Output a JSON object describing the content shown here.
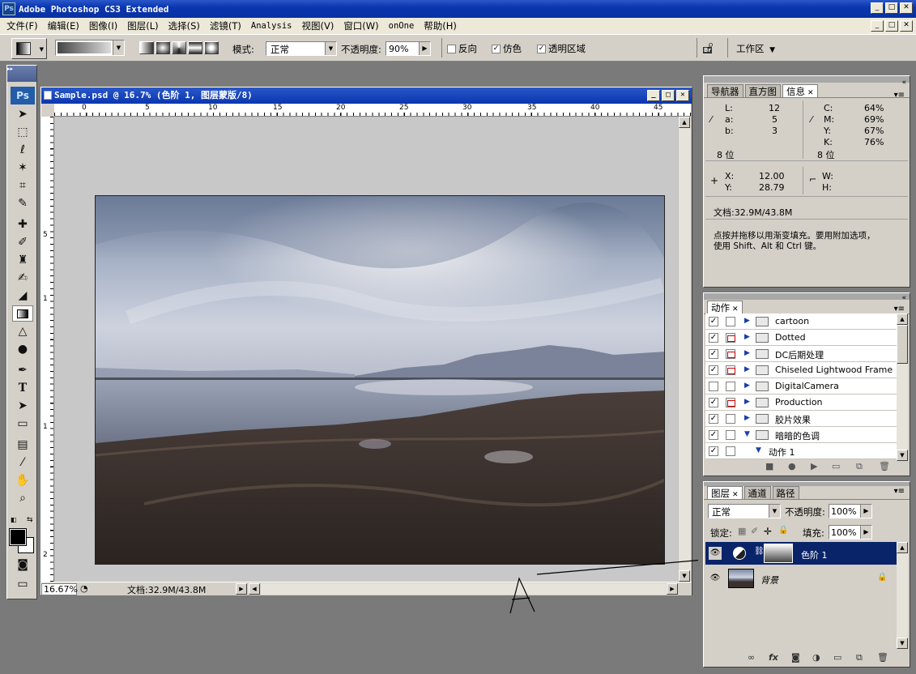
{
  "window": {
    "title": "Adobe Photoshop CS3 Extended",
    "app_icon": "Ps"
  },
  "menu": [
    "文件(F)",
    "编辑(E)",
    "图像(I)",
    "图层(L)",
    "选择(S)",
    "滤镜(T)",
    "Analysis",
    "视图(V)",
    "窗口(W)",
    "onOne",
    "帮助(H)"
  ],
  "options": {
    "mode_label": "模式:",
    "mode_value": "正常",
    "opacity_label": "不透明度:",
    "opacity_value": "90%",
    "reverse_label": "反向",
    "dither_label": "仿色",
    "transparency_label": "透明区域",
    "workspace_label": "工作区",
    "bridge_label": "Br"
  },
  "tools": {
    "logo": "Ps"
  },
  "document": {
    "title": "Sample.psd @ 16.7% (色阶 1, 图层蒙版/8)",
    "ruler_h": [
      "0",
      "5",
      "10",
      "15",
      "20",
      "25",
      "30",
      "35",
      "40",
      "45"
    ],
    "ruler_v": [
      "5",
      "1",
      "1",
      "2"
    ],
    "zoom": "16.67%",
    "doc_size": "文档:32.9M/43.8M"
  },
  "info_panel": {
    "tabs": [
      "导航器",
      "直方图",
      "信息"
    ],
    "L": "12",
    "a": "5",
    "b": "3",
    "C": "64%",
    "M": "69%",
    "Y": "67%",
    "K": "76%",
    "bit_left": "8 位",
    "bit_right": "8 位",
    "X": "12.00",
    "Yc": "28.79",
    "W": "",
    "H": "",
    "doc_size": "文档:32.9M/43.8M",
    "hint_line1": "点按并拖移以用渐变填充。要用附加选项，",
    "hint_line2": "使用 Shift、Alt 和 Ctrl 键。"
  },
  "actions_panel": {
    "tab": "动作",
    "rows": [
      {
        "label": "cartoon",
        "checked": true,
        "dialog": false,
        "open": false
      },
      {
        "label": "Dotted",
        "checked": true,
        "dialog": true,
        "open": false
      },
      {
        "label": "DC后期处理",
        "checked": true,
        "dialog": true,
        "open": false
      },
      {
        "label": "Chiseled Lightwood Frame",
        "checked": true,
        "dialog": true,
        "open": false
      },
      {
        "label": "DigitalCamera",
        "checked": false,
        "dialog": false,
        "open": false
      },
      {
        "label": "Production",
        "checked": true,
        "dialog": true,
        "open": false
      },
      {
        "label": "胶片效果",
        "checked": true,
        "dialog": false,
        "open": false
      },
      {
        "label": "暗暗的色调",
        "checked": true,
        "dialog": false,
        "open": true
      },
      {
        "label": "动作 1",
        "checked": true,
        "dialog": false,
        "open": true
      }
    ]
  },
  "layers_panel": {
    "tabs": [
      "图层",
      "通道",
      "路径"
    ],
    "blend_mode": "正常",
    "opacity_label": "不透明度:",
    "opacity_value": "100%",
    "lock_label": "锁定:",
    "fill_label": "填充:",
    "fill_value": "100%",
    "layers": [
      {
        "name": "色阶 1",
        "selected": true
      },
      {
        "name": "背景",
        "selected": false
      }
    ]
  },
  "annotation": {
    "text": "A"
  }
}
